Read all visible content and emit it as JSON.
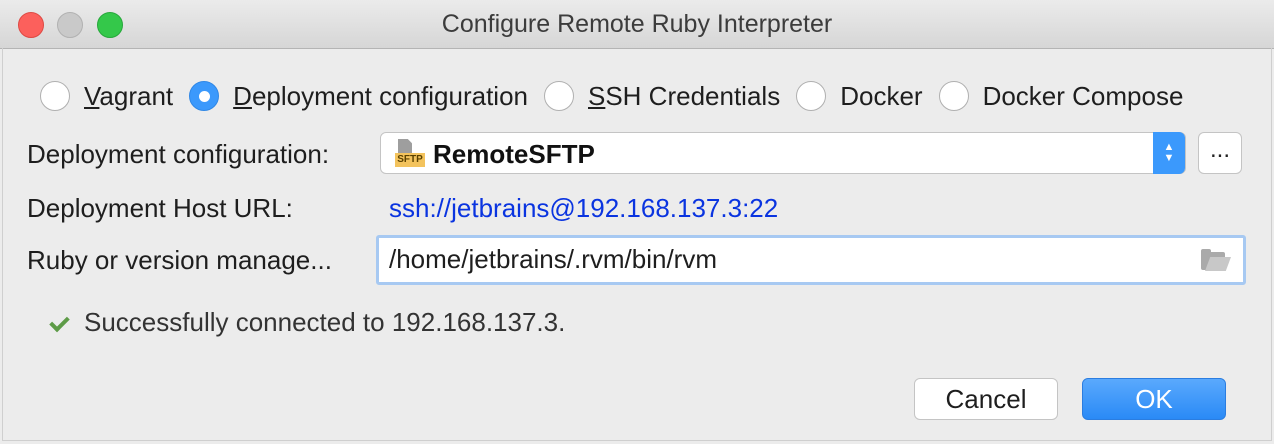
{
  "window": {
    "title": "Configure Remote Ruby Interpreter"
  },
  "radios": [
    {
      "label": "Vagrant",
      "mnemonic": "V",
      "rest": "agrant",
      "selected": false
    },
    {
      "label": "Deployment configuration",
      "mnemonic": "D",
      "rest": "eployment configuration",
      "selected": true
    },
    {
      "label": "SSH Credentials",
      "mnemonic": "S",
      "rest": "SH Credentials",
      "selected": false
    },
    {
      "label": "Docker",
      "mnemonic": "",
      "rest": "Docker",
      "selected": false
    },
    {
      "label": "Docker Compose",
      "mnemonic": "",
      "rest": "Docker Compose",
      "selected": false
    }
  ],
  "deployment": {
    "label": "Deployment configuration:",
    "value": "RemoteSFTP",
    "icon": "sftp-icon",
    "icon_tag": "SFTP",
    "browse_label": "..."
  },
  "host": {
    "label": "Deployment Host URL:",
    "url": "ssh://jetbrains@192.168.137.3:22",
    "url_color": "#0a34e0"
  },
  "ruby": {
    "label": "Ruby or version manage...",
    "value": "/home/jetbrains/.rvm/bin/rvm"
  },
  "status": {
    "icon": "check-icon",
    "text": "Successfully connected to 192.168.137.3."
  },
  "buttons": {
    "cancel": "Cancel",
    "ok": "OK"
  },
  "colors": {
    "accent": "#3b99fc",
    "success": "#5d9b47"
  }
}
